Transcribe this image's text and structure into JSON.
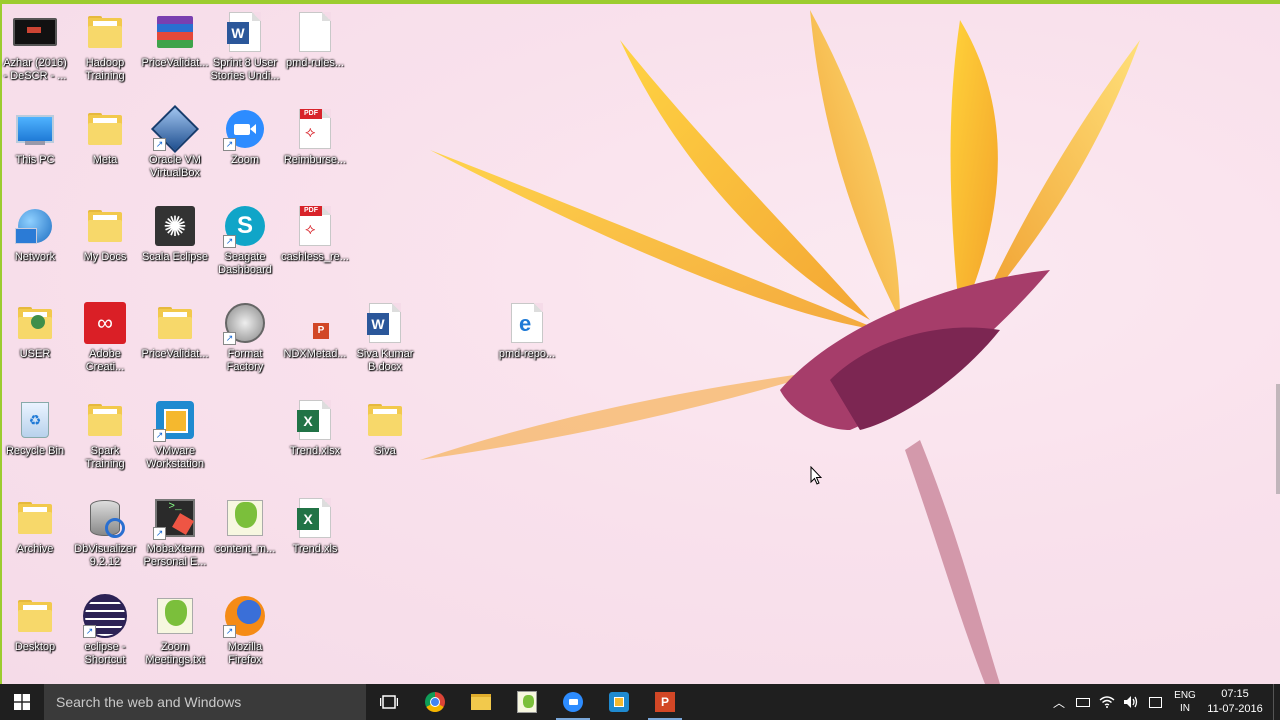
{
  "desktop_icons": [
    {
      "label": "Azhar (2016) - DeSCR - ..."
    },
    {
      "label": "Hadoop Training"
    },
    {
      "label": "PriceValidat..."
    },
    {
      "label": "Sprint 8 User Stories Undi..."
    },
    {
      "label": "pmd-rules..."
    },
    {
      "label": "This PC"
    },
    {
      "label": "Meta"
    },
    {
      "label": "Oracle VM VirtualBox"
    },
    {
      "label": "Zoom"
    },
    {
      "label": "Reimburse..."
    },
    {
      "label": "Network"
    },
    {
      "label": "My Docs"
    },
    {
      "label": "Scala Eclipse"
    },
    {
      "label": "Seagate Dashboard"
    },
    {
      "label": "cashless_re..."
    },
    {
      "label": "USER"
    },
    {
      "label": "Adobe Creati..."
    },
    {
      "label": "PriceValidat..."
    },
    {
      "label": "Format Factory"
    },
    {
      "label": "NDXMetad..."
    },
    {
      "label": "Siva Kumar B.docx"
    },
    {
      "label": "pmd-repo..."
    },
    {
      "label": "Recycle Bin"
    },
    {
      "label": "Spark Training"
    },
    {
      "label": "VMware Workstation"
    },
    {
      "label": "Trend.xlsx"
    },
    {
      "label": "Siva"
    },
    {
      "label": "Archive"
    },
    {
      "label": "DbVisualizer 9.2.12"
    },
    {
      "label": "MobaXterm Personal E..."
    },
    {
      "label": "content_m..."
    },
    {
      "label": "Trend.xls"
    },
    {
      "label": "Desktop"
    },
    {
      "label": "eclipse - Shortcut"
    },
    {
      "label": "Zoom Meetings.txt"
    },
    {
      "label": "Mozilla Firefox"
    }
  ],
  "taskbar": {
    "search_placeholder": "Search the web and Windows",
    "apps": [
      "task-view",
      "chrome",
      "file-explorer",
      "notepad-plus",
      "zoom",
      "vmware",
      "powerpoint"
    ],
    "language_top": "ENG",
    "language_bottom": "IN",
    "time": "07:15",
    "date": "11-07-2016"
  },
  "colors": {
    "accent": "#9ccc2f",
    "taskbar": "#1f1f1f",
    "search": "#3a3a3a"
  }
}
